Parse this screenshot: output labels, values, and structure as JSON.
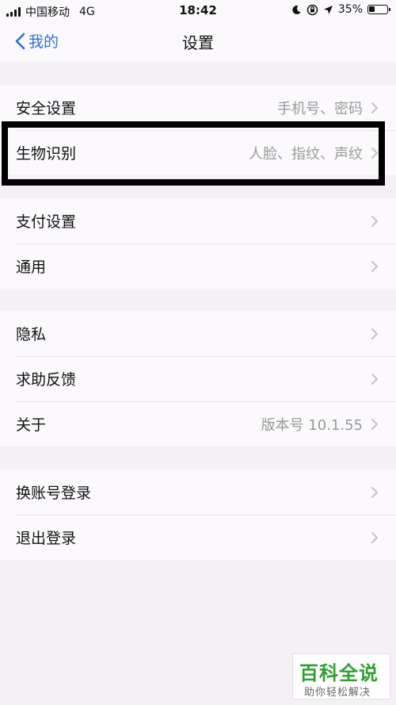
{
  "status_bar": {
    "carrier": "中国移动",
    "network": "4G",
    "time": "18:42",
    "battery": "35%",
    "battery_level": 0.35
  },
  "nav": {
    "back_label": "我的",
    "title": "设置"
  },
  "groups": [
    {
      "items": [
        {
          "label": "安全设置",
          "value": "手机号、密码"
        },
        {
          "label": "生物识别",
          "value": "人脸、指纹、声纹"
        }
      ]
    },
    {
      "items": [
        {
          "label": "支付设置",
          "value": ""
        },
        {
          "label": "通用",
          "value": ""
        }
      ]
    },
    {
      "items": [
        {
          "label": "隐私",
          "value": ""
        },
        {
          "label": "求助反馈",
          "value": ""
        },
        {
          "label": "关于",
          "value": "版本号 10.1.55"
        }
      ]
    },
    {
      "items": [
        {
          "label": "换账号登录",
          "value": ""
        },
        {
          "label": "退出登录",
          "value": ""
        }
      ]
    }
  ],
  "watermark": {
    "title": "百科全说",
    "subtitle": "助你轻松解决"
  },
  "colors": {
    "accent": "#2d6fe0",
    "background": "#f4f0f6",
    "row_background": "#fbf9fc",
    "secondary_text": "#9a9a9a",
    "watermark_green": "#2ea12e"
  }
}
